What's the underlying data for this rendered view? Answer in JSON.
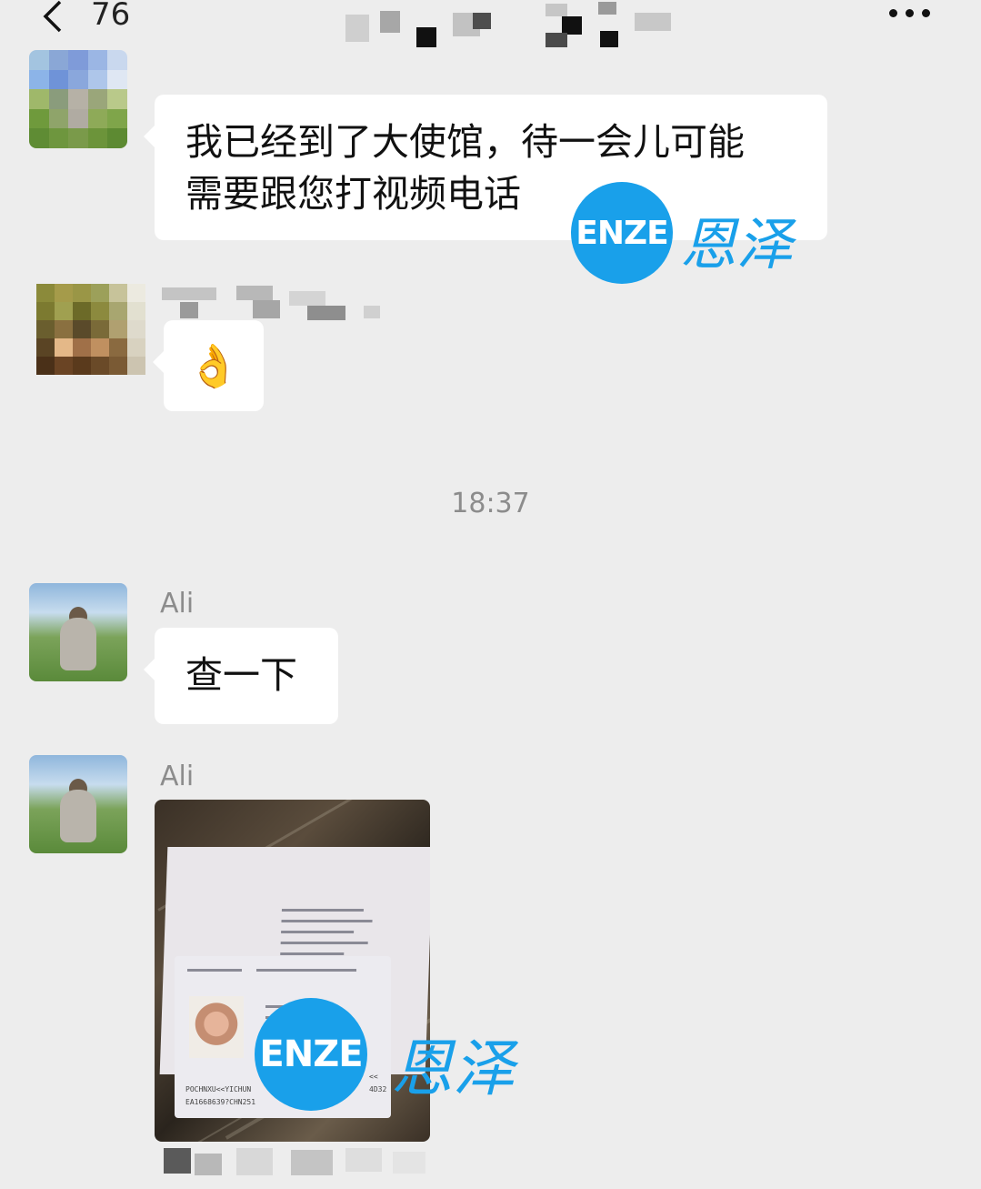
{
  "header": {
    "back_count": "76",
    "back_icon": "chevron-left-icon",
    "more_icon": "more-icon"
  },
  "messages": [
    {
      "sender": "",
      "text_line1": "我已经到了大使馆，待一会儿可能",
      "text_line2": "需要跟您打视频电话"
    },
    {
      "sender": "",
      "emoji": "👌"
    },
    {
      "sender": "Ali",
      "text": "查一下"
    },
    {
      "sender": "Ali",
      "type": "image"
    }
  ],
  "timestamp": "18:37",
  "passport": {
    "mrz_line1": "POCHNXU<<YICHUN",
    "mrz_line2": "EA1668639?CHN251",
    "mrz_tail": "<<",
    "mrz_tail2": "4D32"
  },
  "watermark": {
    "logo": "ENZE",
    "chinese": "恩泽"
  }
}
